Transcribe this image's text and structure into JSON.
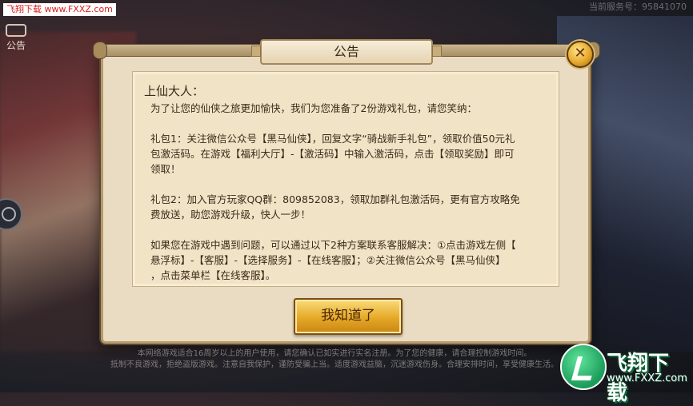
{
  "watermark": "飞翔下载 www.FXXZ.com",
  "corner_button": {
    "label": "公告"
  },
  "server_info": "当前服务号：95841070",
  "dialog": {
    "title": "公告",
    "greeting": "上仙大人：",
    "intro": "为了让您的仙侠之旅更加愉快，我们为您准备了2份游戏礼包，请您笑纳：",
    "gift1": [
      "礼包1：关注微信公众号【黑马仙侠】，回复文字“骑战新手礼包”，领取价值50元礼",
      "包激活码。在游戏【福利大厅】-【激活码】中输入激活码，点击【领取奖励】即可",
      "领取！"
    ],
    "gift2": [
      "礼包2：加入官方玩家QQ群：809852083，领取加群礼包激活码，更有官方攻略免",
      "费放送，助您游戏升级，快人一步！"
    ],
    "help": [
      "如果您在游戏中遇到问题，可以通过以下2种方案联系客服解决：①点击游戏左侧【",
      "悬浮标】-【客服】-【选择服务】-【在线客服】；②关注微信公众号【黑马仙侠】",
      "，点击菜单栏【在线客服】。"
    ],
    "ok_label": "我知道了",
    "close_glyph": "✕"
  },
  "footer": [
    "本网络游戏适合16周岁以上的用户使用，请您确认已如实进行实名注册。为了您的健康，请合理控制游戏时间。",
    "抵制不良游戏，拒绝盗版游戏。注意自我保护，谨防受骗上当。适度游戏益脑，沉迷游戏伤身。合理安排时间，享受健康生活。"
  ],
  "brand": {
    "name": "飞翔下载",
    "url": "www.FXXZ.com"
  }
}
